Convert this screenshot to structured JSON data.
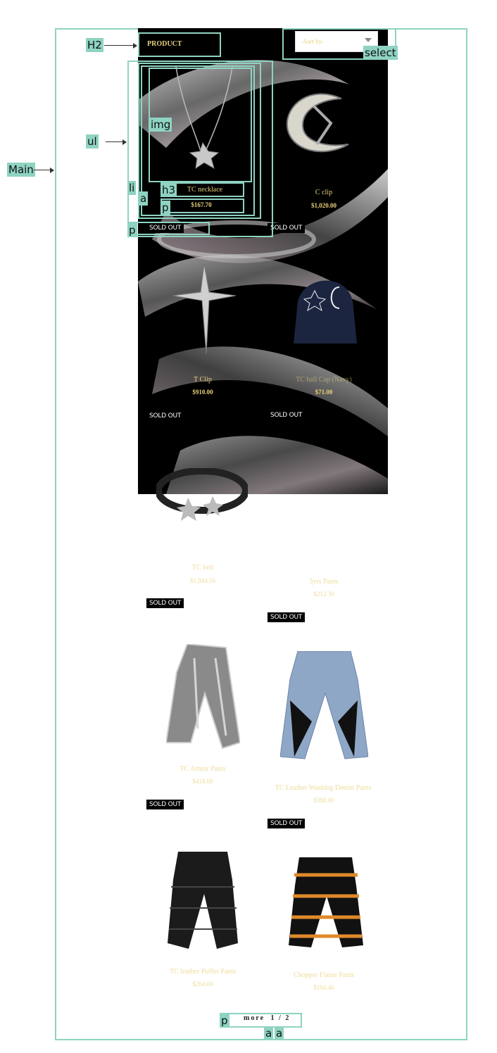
{
  "main": {
    "heading": "PRODUCT",
    "sort": {
      "placeholder": "-Sort by-"
    }
  },
  "products": [
    {
      "name": "TC necklace",
      "price": "$167.70",
      "status": "SOLD OUT"
    },
    {
      "name": "C clip",
      "price": "$1,020.00",
      "status": "SOLD OUT"
    },
    {
      "name": "T Clip",
      "price": "$910.00",
      "status": "SOLD OUT"
    },
    {
      "name": "TC ball Cap (Navy)",
      "price": "$71.00",
      "status": "SOLD OUT"
    },
    {
      "name": "TC belt",
      "price": "$1,944.56",
      "status": "SOLD OUT"
    },
    {
      "name": "3yrs Pants",
      "price": "$212.30",
      "status": "SOLD OUT"
    },
    {
      "name": "TC Armor Pants",
      "price": "$418.00",
      "status": "SOLD OUT"
    },
    {
      "name": "TC Leather Washing Denim Pants",
      "price": "$388.00",
      "status": "SOLD OUT"
    },
    {
      "name": "TC leather Puffer Pants",
      "price": "$264.00"
    },
    {
      "name": "Chopper Flame Pants",
      "price": "$194.46"
    }
  ],
  "pagination": {
    "more": "more",
    "pages": [
      "1",
      "2"
    ]
  },
  "annotations": {
    "main": "Main",
    "h2": "H2",
    "select": "select",
    "ul": "ul",
    "img": "img",
    "li": "li",
    "a": "a",
    "h3": "h3",
    "p": "p"
  },
  "colors": {
    "annotation": "#8fd3c2",
    "product_text": "#e8d07a",
    "badge_bg": "#000000"
  }
}
